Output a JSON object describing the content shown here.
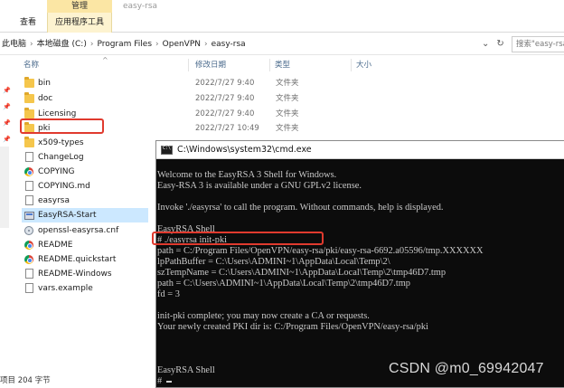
{
  "ribbon": {
    "context_group": "管理",
    "app_name": "easy-rsa",
    "tab_view": "查看",
    "tab_app_tools": "应用程序工具"
  },
  "address": {
    "crumbs": [
      "此电脑",
      "本地磁盘 (C:)",
      "Program Files",
      "OpenVPN",
      "easy-rsa"
    ],
    "search_placeholder": "搜索\"easy-rsa\""
  },
  "columns": {
    "name": "名称",
    "date": "修改日期",
    "type": "类型",
    "size": "大小"
  },
  "files": [
    {
      "name": "bin",
      "date": "2022/7/27 9:40",
      "type": "文件夹",
      "icon": "folder-icon"
    },
    {
      "name": "doc",
      "date": "2022/7/27 9:40",
      "type": "文件夹",
      "icon": "folder-icon"
    },
    {
      "name": "Licensing",
      "date": "2022/7/27 9:40",
      "type": "文件夹",
      "icon": "folder-icon"
    },
    {
      "name": "pki",
      "date": "2022/7/27 10:49",
      "type": "文件夹",
      "icon": "folder-icon"
    },
    {
      "name": "x509-types",
      "date": "",
      "type": "",
      "icon": "folder-icon"
    },
    {
      "name": "ChangeLog",
      "date": "",
      "type": "",
      "icon": "document-icon"
    },
    {
      "name": "COPYING",
      "date": "",
      "type": "",
      "icon": "chrome-icon"
    },
    {
      "name": "COPYING.md",
      "date": "",
      "type": "",
      "icon": "document-icon"
    },
    {
      "name": "easyrsa",
      "date": "",
      "type": "",
      "icon": "document-icon"
    },
    {
      "name": "EasyRSA-Start",
      "date": "",
      "type": "",
      "icon": "batch-file-icon"
    },
    {
      "name": "openssl-easyrsa.cnf",
      "date": "",
      "type": "",
      "icon": "config-file-icon"
    },
    {
      "name": "README",
      "date": "",
      "type": "",
      "icon": "chrome-icon"
    },
    {
      "name": "README.quickstart",
      "date": "",
      "type": "",
      "icon": "chrome-icon"
    },
    {
      "name": "README-Windows",
      "date": "",
      "type": "",
      "icon": "document-icon"
    },
    {
      "name": "vars.example",
      "date": "",
      "type": "",
      "icon": "document-icon"
    }
  ],
  "status": {
    "text": "项目 204 字节"
  },
  "cmd": {
    "title": "C:\\Windows\\system32\\cmd.exe",
    "lines": [
      "",
      "Welcome to the EasyRSA 3 Shell for Windows.",
      "Easy-RSA 3 is available under a GNU GPLv2 license.",
      "",
      "Invoke './easyrsa' to call the program. Without commands, help is displayed.",
      "",
      "EasyRSA Shell",
      "# ./easyrsa init-pki",
      "path = C:/Program Files/OpenVPN/easy-rsa/pki/easy-rsa-6692.a05596/tmp.XXXXXX",
      "lpPathBuffer = C:\\Users\\ADMINI~1\\AppData\\Local\\Temp\\2\\",
      "szTempName = C:\\Users\\ADMINI~1\\AppData\\Local\\Temp\\2\\tmp46D7.tmp",
      "path = C:\\Users\\ADMINI~1\\AppData\\Local\\Temp\\2\\tmp46D7.tmp",
      "fd = 3",
      "",
      "init-pki complete; you may now create a CA or requests.",
      "Your newly created PKI dir is: C:/Program Files/OpenVPN/easy-rsa/pki",
      "",
      "",
      "",
      "EasyRSA Shell",
      "# "
    ]
  },
  "watermark": "CSDN @m0_69942047",
  "colors": {
    "highlight_box": "#e03a2e",
    "selection": "#cce8ff",
    "ribbon_context": "#fbe6a4",
    "console_bg": "#0c0c0c",
    "console_text": "#c9c9c9"
  }
}
